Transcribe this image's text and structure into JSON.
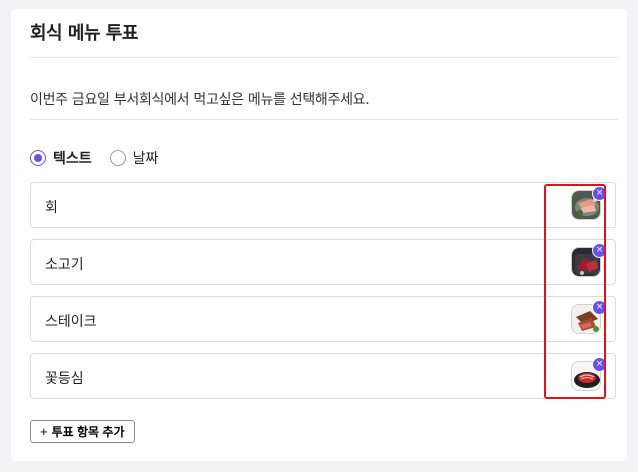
{
  "poll": {
    "title": "회식 메뉴 투표",
    "description": "이번주 금요일 부서회식에서 먹고싶은 메뉴를 선택해주세요."
  },
  "type_options": [
    {
      "label": "텍스트",
      "checked": true
    },
    {
      "label": "날짜",
      "checked": false
    }
  ],
  "options": [
    {
      "label": "회",
      "image": "sashimi-photo"
    },
    {
      "label": "소고기",
      "image": "beef-grill-photo"
    },
    {
      "label": "스테이크",
      "image": "steak-photo"
    },
    {
      "label": "꽃등심",
      "image": "ribeye-plate-photo"
    }
  ],
  "add_button": {
    "icon": "+",
    "label": "투표 항목 추가"
  },
  "remove_icon": "×",
  "colors": {
    "accent": "#6a4ff0",
    "highlight": "#e5101d"
  }
}
